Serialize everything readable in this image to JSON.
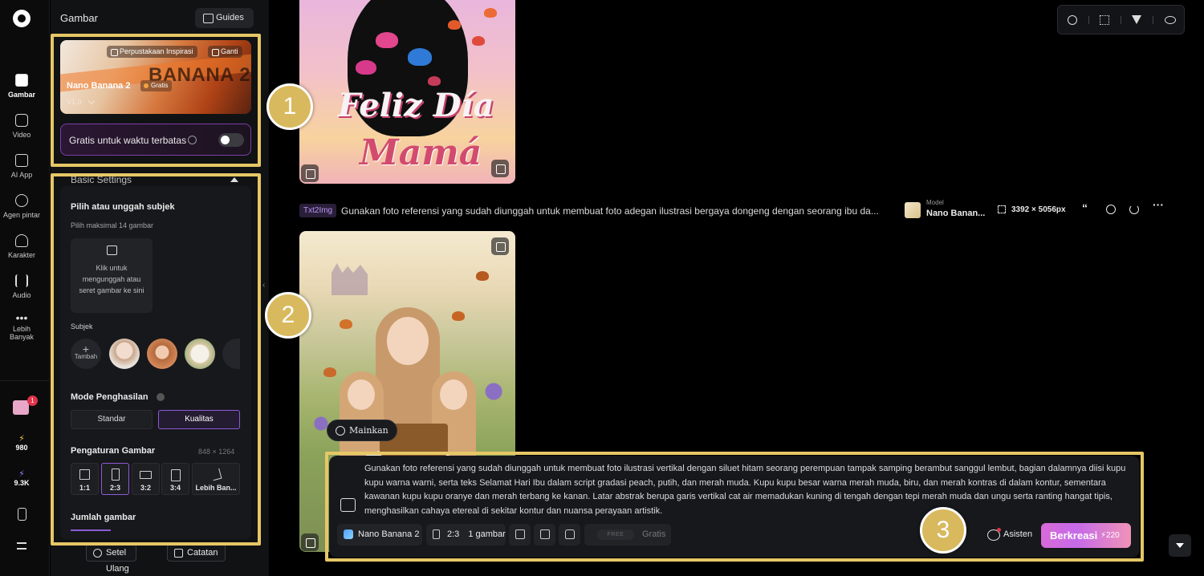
{
  "rail": {
    "items": [
      {
        "label": "Gambar",
        "icon": "image-icon"
      },
      {
        "label": "Video",
        "icon": "video-icon"
      },
      {
        "label": "AI App",
        "icon": "ai-app-icon"
      },
      {
        "label": "Agen pintar",
        "icon": "agent-icon"
      },
      {
        "label": "Karakter",
        "icon": "character-icon"
      },
      {
        "label": "Audio",
        "icon": "audio-icon"
      },
      {
        "label": "Lebih Banyak",
        "icon": "more-icon"
      }
    ],
    "gift_badge": "1",
    "credits": "980",
    "points": "9.3K"
  },
  "panel": {
    "title": "Gambar",
    "guides_label": "Guides",
    "model_card": {
      "library_label": "Perpustakaan Inspirasi",
      "switch_label": "Ganti",
      "banner_text": "BANANA 2",
      "name": "Nano Banana 2",
      "badge": "Gratis",
      "version": "V1.0"
    },
    "free_limited": "Gratis untuk waktu terbatas",
    "basic_settings": "Basic Settings",
    "subject": {
      "heading": "Pilih atau unggah subjek",
      "max_hint": "Pilih maksimal 14 gambar",
      "upload_text": "Klik untuk mengunggah atau seret gambar ke sini",
      "label": "Subjek",
      "add_label": "Tambah"
    },
    "mode": {
      "heading": "Mode Penghasilan",
      "standard": "Standar",
      "quality": "Kualitas"
    },
    "image_settings": {
      "heading": "Pengaturan Gambar",
      "size": "848 × 1264",
      "ratios": [
        "1:1",
        "2:3",
        "3:2",
        "3:4",
        "Lebih Ban..."
      ],
      "selected_ratio": "2:3"
    },
    "count_heading": "Jumlah gambar",
    "reset_label": "Setel Ulang",
    "notes_label": "Catatan"
  },
  "gallery": {
    "image1_title_line1": "Feliz Día",
    "image1_title_line2": "Mamá",
    "meta": {
      "tag": "Txt2Img",
      "prompt": "Gunakan foto referensi yang sudah diunggah untuk membuat foto adegan ilustrasi bergaya dongeng dengan seorang ibu da...",
      "model_label": "Model",
      "model_value": "Nano Banan...",
      "resolution": "3392 × 5056px"
    },
    "play_label": "Mainkan"
  },
  "composer": {
    "prompt": "Gunakan foto referensi yang sudah diunggah untuk membuat foto ilustrasi vertikal dengan siluet hitam seorang perempuan tampak samping berambut sanggul lembut, bagian dalamnya diisi kupu kupu warna warni, serta teks Selamat Hari Ibu dalam script gradasi peach, putih, dan merah muda. Kupu kupu besar warna merah muda, biru, dan merah kontras di dalam kontur, sementara kawanan kupu kupu oranye dan merah terbang ke kanan. Latar abstrak berupa garis vertikal cat air memadukan kuning di tengah dengan tepi merah muda dan ungu serta ranting hangat tipis, menghasilkan cahaya etereal di sekitar kontur dan nuansa perayaan artistik.",
    "model": "Nano Banana 2",
    "ratio": "2:3",
    "count": "1 gambar",
    "free_tag": "FREE",
    "free_label": "Gratis",
    "assistant": "Asisten",
    "create_label": "Berkreasi",
    "create_cost": "220"
  },
  "annotations": [
    "1",
    "2",
    "3"
  ],
  "colors": {
    "accent": "#8c5bd6",
    "highlight": "#e6c766",
    "create_gradient_start": "#d86ad8"
  }
}
